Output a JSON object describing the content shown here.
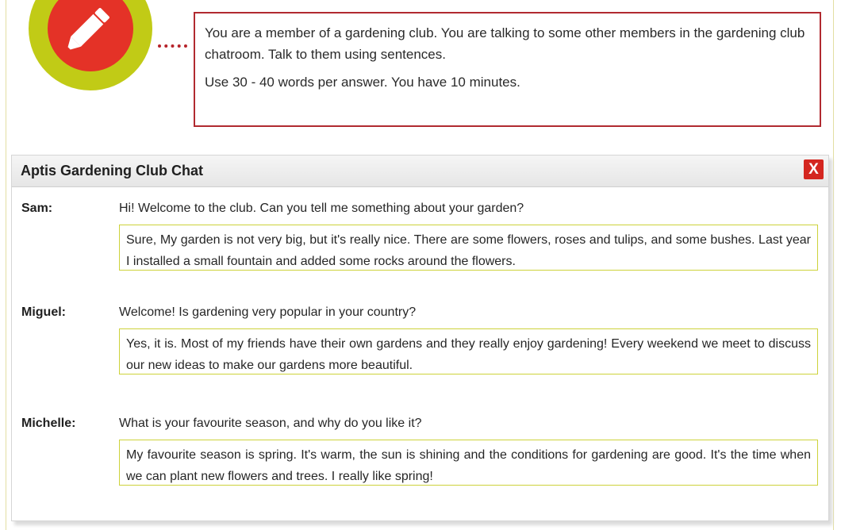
{
  "instructions": {
    "line1": "You are a member of a gardening club. You are talking to some other members in the gardening club chatroom. Talk to them using sentences.",
    "line2": "Use 30 - 40 words per answer. You have 10 minutes."
  },
  "chat": {
    "title": "Aptis Gardening Club Chat",
    "close_label": "X",
    "messages": [
      {
        "speaker": "Sam:",
        "question": "Hi! Welcome to the club. Can you tell me something about your garden?",
        "answer": "Sure, My garden is not very big, but it's really nice. There are some flowers, roses and tulips, and some bushes. Last year I installed a small fountain and added some rocks around the flowers."
      },
      {
        "speaker": "Miguel:",
        "question": "Welcome! Is gardening very popular in your country?",
        "answer": "Yes, it is. Most of my friends have their own gardens and they really enjoy gardening! Every weekend we meet to discuss our new ideas to make our gardens more beautiful."
      },
      {
        "speaker": "Michelle:",
        "question": "What is your favourite season, and why do you like it?",
        "answer": "My favourite season is spring. It's warm, the sun is shining and the conditions for gardening are good. It's the time when we can plant new flowers and trees. I really like spring!"
      }
    ]
  },
  "colors": {
    "ring": "#c1cb16",
    "disc": "#e43227",
    "border_red": "#b12a30",
    "answer_border": "#cdd23a"
  },
  "icons": {
    "task_icon": "pencil-icon"
  }
}
